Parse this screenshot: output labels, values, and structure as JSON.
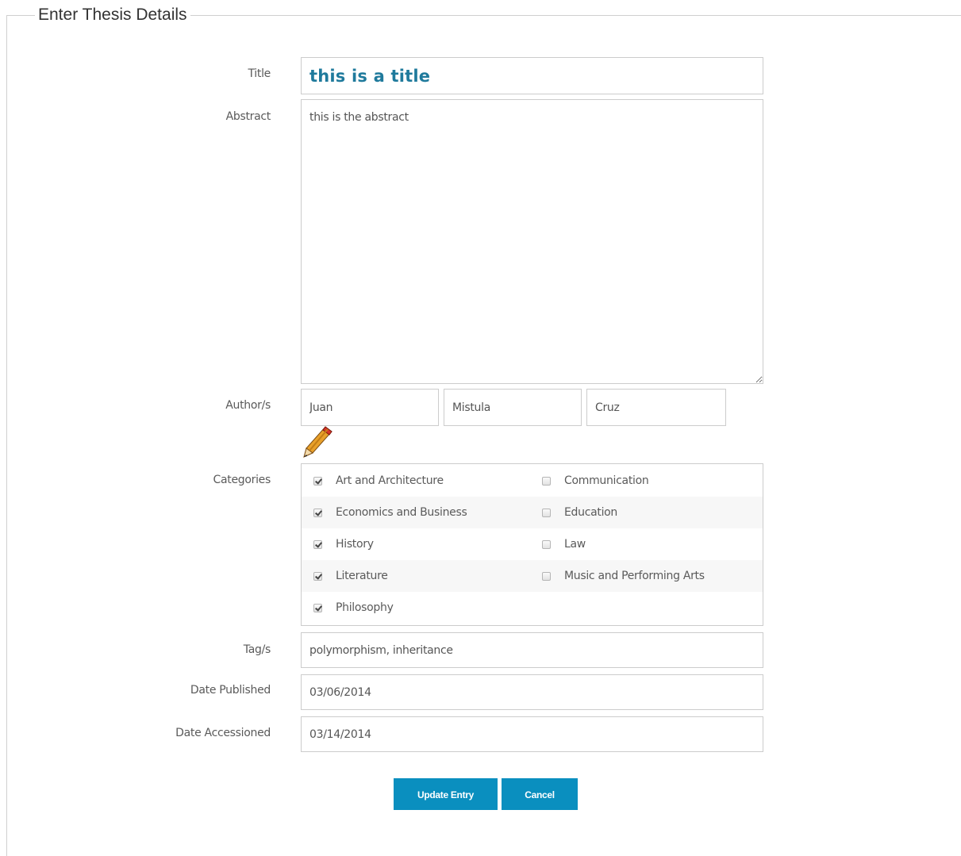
{
  "form": {
    "legend": "Enter Thesis Details",
    "labels": {
      "title": "Title",
      "abstract": "Abstract",
      "authors": "Author/s",
      "categories": "Categories",
      "tags": "Tag/s",
      "date_published": "Date Published",
      "date_accessioned": "Date Accessioned"
    },
    "title_value": "this is a title",
    "abstract_value": "this is the abstract",
    "authors": {
      "first": "Juan",
      "middle": "Mistula",
      "last": "Cruz"
    },
    "categories": [
      {
        "label": "Art and Architecture",
        "checked": true
      },
      {
        "label": "Communication",
        "checked": false
      },
      {
        "label": "Economics and Business",
        "checked": true
      },
      {
        "label": "Education",
        "checked": false
      },
      {
        "label": "History",
        "checked": true
      },
      {
        "label": "Law",
        "checked": false
      },
      {
        "label": "Literature",
        "checked": true
      },
      {
        "label": "Music and Performing Arts",
        "checked": false
      },
      {
        "label": "Philosophy",
        "checked": true
      }
    ],
    "tags_value": "polymorphism, inheritance",
    "date_published_value": "03/06/2014",
    "date_accessioned_value": "03/14/2014"
  },
  "buttons": {
    "update": "Update Entry",
    "cancel": "Cancel"
  },
  "colors": {
    "accent": "#0a8fbf",
    "title_text": "#1f7a9c"
  },
  "icons": {
    "edit_authors": "pencil-icon"
  }
}
